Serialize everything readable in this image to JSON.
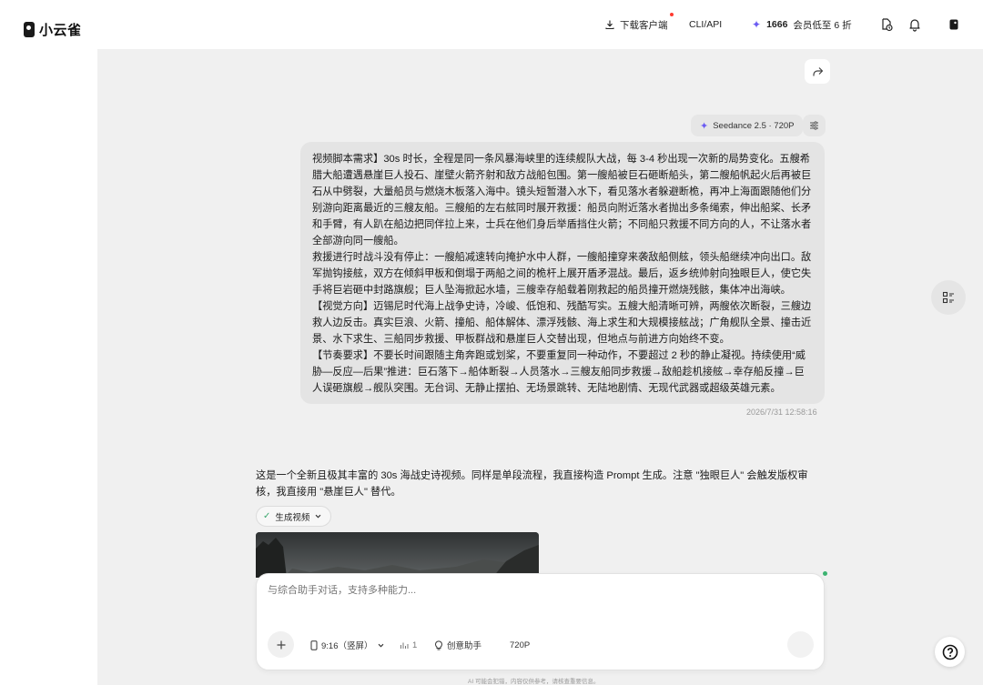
{
  "brand": {
    "name": "小云雀"
  },
  "header": {
    "download_label": "下载客户端",
    "cli_label": "CLI/API",
    "credits_value": "1666",
    "credits_promo": "会员低至 6 折"
  },
  "chat": {
    "model_chip": "Seedance 2.5 · 720P",
    "user_message": [
      "视频脚本需求】30s 时长，全程是同一条风暴海峡里的连续舰队大战，每 3-4 秒出现一次新的局势变化。五艘希腊大船遭遇悬崖巨人投石、崖壁火箭齐射和敌方战船包围。第一艘船被巨石砸断船头，第二艘船帆起火后再被巨石从中劈裂，大量船员与燃烧木板落入海中。镜头短暂潜入水下，看见落水者躲避断桅，再冲上海面跟随他们分别游向距离最近的三艘友船。三艘船的左右舷同时展开救援：船员向附近落水者抛出多条绳索，伸出船桨、长矛和手臂，有人趴在船边把同伴拉上来，士兵在他们身后举盾挡住火箭；不同船只救援不同方向的人，不让落水者全部游向同一艘船。",
      "救援进行时战斗没有停止：一艘船减速转向掩护水中人群，一艘船撞穿来袭敌船侧舷，领头船继续冲向出口。敌军抛钩接舷，双方在倾斜甲板和倒塌于两船之间的桅杆上展开盾矛混战。最后，返乡统帅射向独眼巨人，使它失手将巨岩砸中封路旗舰；巨人坠海掀起水墙，三艘幸存船载着刚救起的船员撞开燃烧残骸，集体冲出海峡。",
      "【视觉方向】迈锡尼时代海上战争史诗，冷峻、低饱和、残酷写实。五艘大船清晰可辨，两艘依次断裂，三艘边救人边反击。真实巨浪、火箭、撞船、船体解体、漂浮残骸、海上求生和大规模接舷战；广角舰队全景、撞击近景、水下求生、三船同步救援、甲板群战和悬崖巨人交替出现，但地点与前进方向始终不变。",
      "【节奏要求】不要长时间跟随主角奔跑或划桨，不要重复同一种动作，不要超过 2 秒的静止凝视。持续使用“威胁—反应—后果”推进：巨石落下→船体断裂→人员落水→三艘友船同步救援→敌船趁机接舷→幸存船反撞→巨人误砸旗舰→舰队突围。无台词、无静止摆拍、无场景跳转、无陆地剧情、无现代武器或超级英雄元素。"
    ],
    "timestamp": "2026/7/31 12:58:16",
    "assistant_message": "这是一个全新且极其丰富的 30s 海战史诗视频。同样是单段流程，我直接构造 Prompt 生成。注意 \"独眼巨人\" 会触发版权审核，我直接用 \"悬崖巨人\" 替代。",
    "generate_chip": "生成视频"
  },
  "composer": {
    "placeholder": "与综合助手对话，支持多种能力...",
    "ratio_label": "9:16（竖屏）",
    "count_label": "1",
    "assistant_label": "创意助手",
    "resolution_label": "720P"
  },
  "footer": {
    "disclaimer": "AI 可能会犯错，内容仅供参考，请核查重要信息。"
  },
  "colors": {
    "accent": "#6b5cf2",
    "success": "#3cb371",
    "notification": "#ff3b30"
  }
}
